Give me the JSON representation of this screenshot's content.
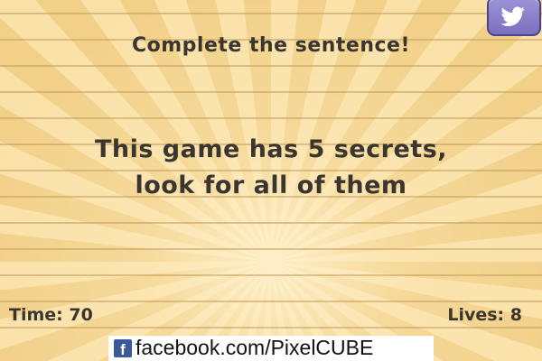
{
  "screen": {
    "heading": "Complete the sentence!",
    "question_lines": [
      "This game has 5 secrets,",
      "look for all of them"
    ]
  },
  "hud": {
    "timer_text": "Time: 70",
    "lives_text": "Lives: 8"
  },
  "share": {
    "twitter_icon": "twitter-bird-icon",
    "twitter_color": "#8a80cb"
  },
  "banner": {
    "facebook_icon": "facebook-icon",
    "facebook_text": "facebook.com/PixelCUBE"
  }
}
